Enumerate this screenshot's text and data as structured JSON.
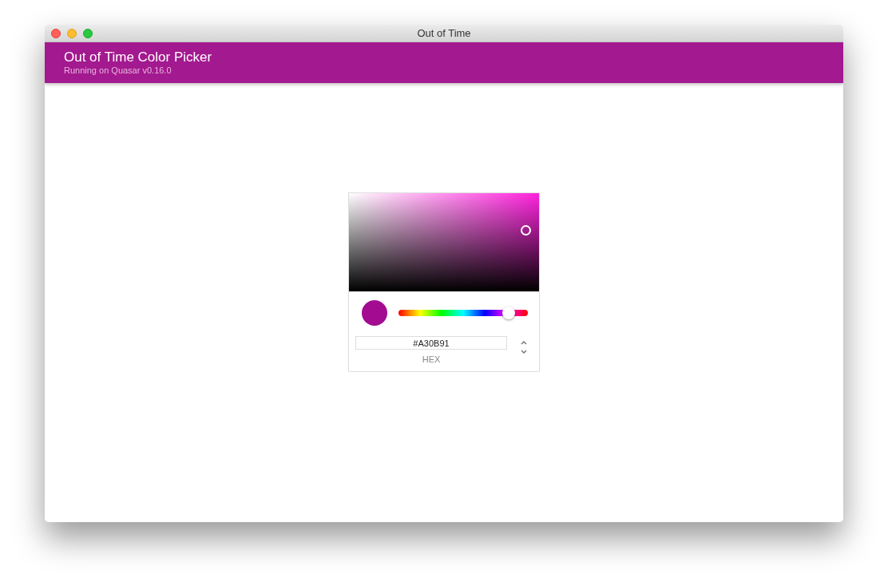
{
  "window": {
    "title": "Out of Time"
  },
  "header": {
    "title": "Out of Time Color Picker",
    "subtitle": "Running on Quasar v0.16.0"
  },
  "picker": {
    "hue": {
      "level": 0.85
    },
    "hex_field": {
      "value": "#A30B91",
      "label": "HEX"
    }
  }
}
